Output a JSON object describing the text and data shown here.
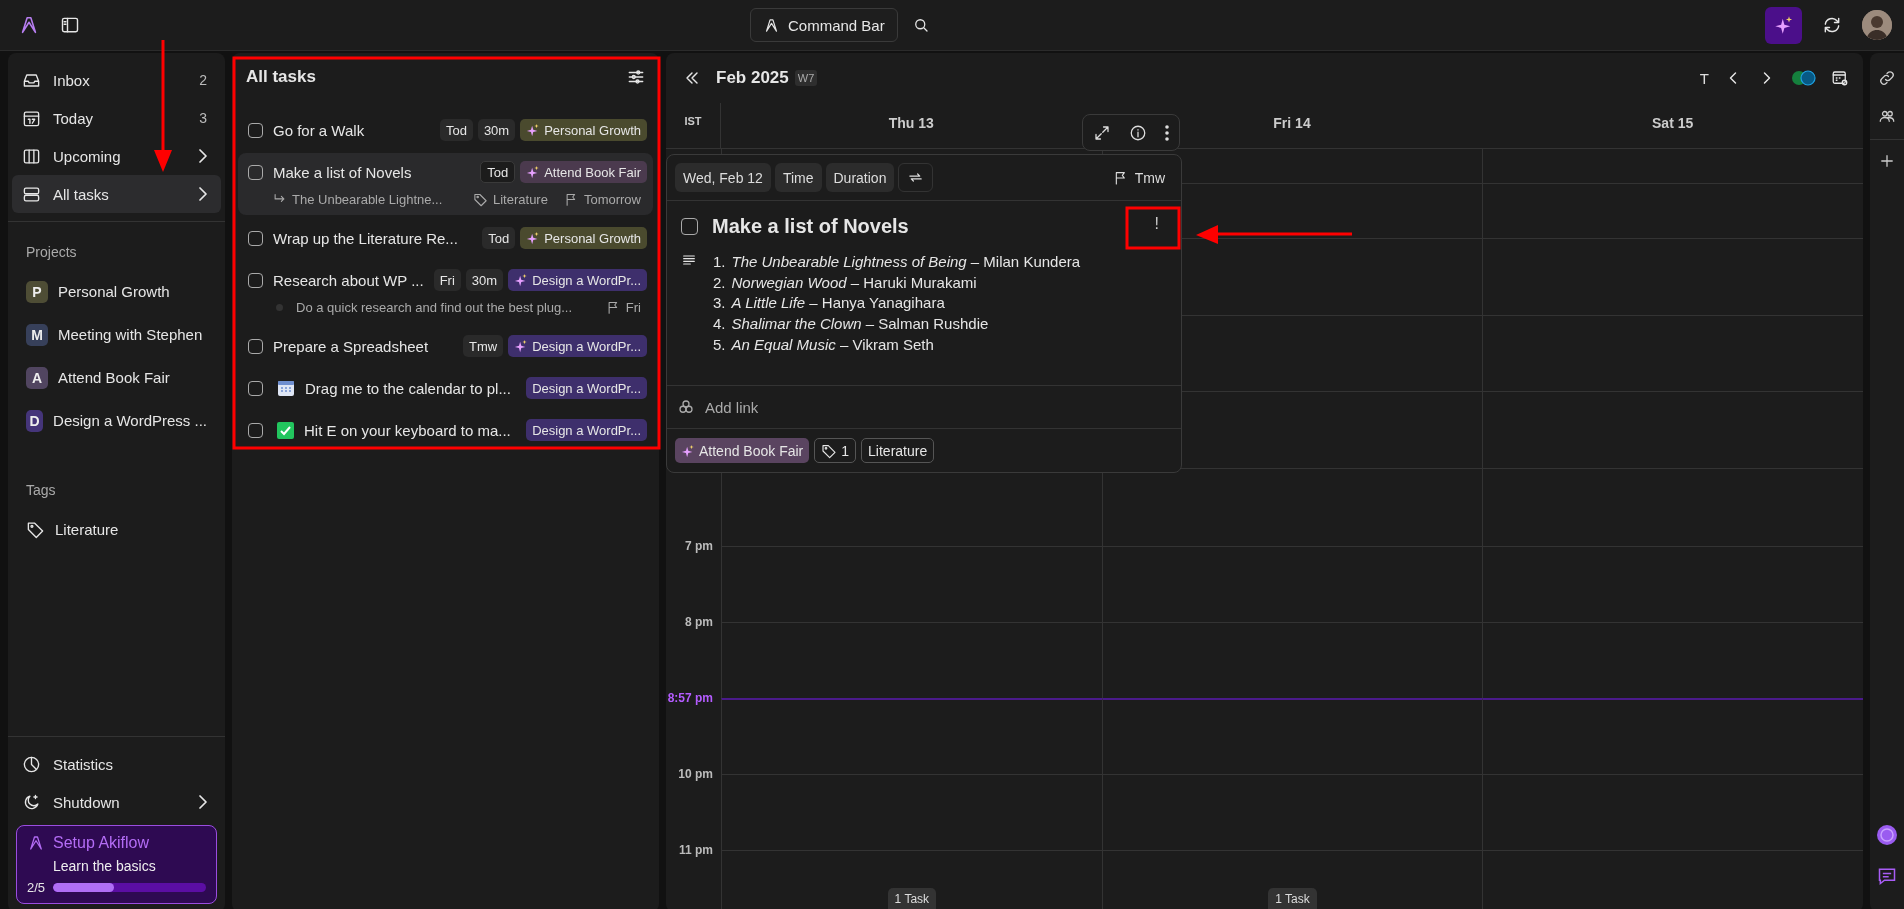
{
  "top_bar": {
    "command_bar": "Command Bar"
  },
  "sidebar": {
    "nav": [
      {
        "label": "Inbox",
        "count": "2",
        "submenu": false,
        "selected": false
      },
      {
        "label": "Today",
        "count": "3",
        "submenu": false,
        "selected": false
      },
      {
        "label": "Upcoming",
        "submenu": true,
        "selected": false
      },
      {
        "label": "All tasks",
        "submenu": true,
        "selected": true
      }
    ],
    "projects_heading": "Projects",
    "projects": [
      {
        "initial": "P",
        "label": "Personal Growth",
        "color": "#4e4d35"
      },
      {
        "initial": "M",
        "label": "Meeting with Stephen",
        "color": "#37405a"
      },
      {
        "initial": "A",
        "label": "Attend Book Fair",
        "color": "#514560"
      },
      {
        "initial": "D",
        "label": "Design a WordPress ...",
        "color": "#45357a"
      }
    ],
    "tags_heading": "Tags",
    "tags": [
      {
        "label": "Literature"
      }
    ],
    "footer": [
      {
        "label": "Statistics",
        "submenu": false
      },
      {
        "label": "Shutdown",
        "submenu": true
      }
    ],
    "setup": {
      "title": "Setup Akiflow",
      "subtitle": "Learn the basics",
      "progress": "2/5",
      "level": 0.4
    }
  },
  "task_list": {
    "title": "All tasks",
    "tasks": [
      {
        "kind": "task",
        "title": "Go for a Walk",
        "checked": false,
        "selected": false,
        "date": "Tod",
        "duration": "30m",
        "project": {
          "label": "Personal Growth",
          "color": "#4a4a2e"
        }
      },
      {
        "kind": "task",
        "title": "Make a list of Novels",
        "checked": false,
        "selected": true,
        "date": "Tod",
        "project": {
          "label": "Attend Book Fair",
          "color": "#4b3a4e"
        },
        "details": [
          {
            "kind": "subtask",
            "text": "The Unbearable Lightne..."
          },
          {
            "kind": "tag",
            "text": "Literature"
          },
          {
            "kind": "deadline",
            "text": "Tomorrow"
          }
        ]
      },
      {
        "kind": "task",
        "title": "Wrap up the Literature Re...",
        "checked": false,
        "selected": false,
        "date": "Tod",
        "project": {
          "label": "Personal Growth",
          "color": "#4a4a2e"
        }
      },
      {
        "kind": "task",
        "title": "Research about WP ...",
        "checked": false,
        "selected": false,
        "date": "Fri",
        "duration": "30m",
        "project": {
          "label": "Design a WordPr...",
          "color": "#3e2f6c"
        },
        "details": [
          {
            "kind": "note",
            "text": "Do a quick research and find out the best plug..."
          },
          {
            "kind": "deadline",
            "text": "Fri"
          }
        ]
      },
      {
        "kind": "task",
        "title": "Prepare a Spreadsheet",
        "checked": false,
        "selected": false,
        "date": "Tmw",
        "project": {
          "label": "Design a WordPr...",
          "color": "#3e2f6c"
        }
      },
      {
        "kind": "onboarding",
        "title": "Drag me to the calendar to pl...",
        "checked": false,
        "selected": false,
        "project": {
          "label": "Design a WordPr...",
          "color": "#3e2f6c"
        }
      },
      {
        "kind": "onboarding",
        "title": "Hit E on your keyboard to ma...",
        "checked": false,
        "selected": false,
        "project": {
          "label": "Design a WordPr...",
          "color": "#3e2f6c"
        }
      }
    ]
  },
  "calendar": {
    "month": "Feb 2025",
    "week": "W7",
    "today_button": "T",
    "timezone": "IST",
    "days": [
      {
        "label": "Thu 13",
        "footer": "1 Task"
      },
      {
        "label": "Fri 14",
        "footer": "1 Task"
      },
      {
        "label": "Sat 15"
      }
    ],
    "hours": [
      {
        "kind": "hour",
        "label": "7 pm"
      },
      {
        "kind": "hour",
        "label": "8 pm"
      },
      {
        "kind": "now",
        "label": "8:57 pm"
      },
      {
        "kind": "hour",
        "label": "10 pm"
      },
      {
        "kind": "hour",
        "label": "11 pm"
      }
    ]
  },
  "popup": {
    "date": "Wed, Feb 12",
    "time": "Time",
    "duration": "Duration",
    "deadline": "Tmw",
    "title": "Make a list of Novels",
    "checked": false,
    "priority": "!",
    "notes": [
      {
        "number": "1.",
        "text": "*The Unbearable Lightness of Being* – Milan Kundera"
      },
      {
        "number": "2.",
        "text": "*Norwegian Wood* – Haruki Murakami"
      },
      {
        "number": "3.",
        "text": "*A Little Life* – Hanya Yanagihara"
      },
      {
        "number": "4.",
        "text": "*Shalimar the Clown* – Salman Rushdie"
      },
      {
        "number": "5.",
        "text": "*An Equal Music* – Vikram Seth"
      }
    ],
    "add_link": "Add link",
    "project": {
      "label": "Attend Book Fair",
      "color": "#5a4460"
    },
    "tag_count": "1",
    "tags": [
      "Literature"
    ]
  }
}
